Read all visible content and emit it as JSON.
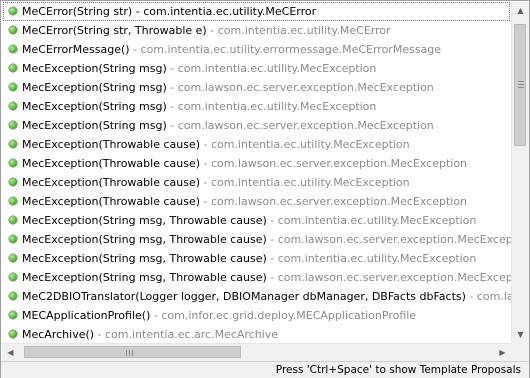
{
  "proposals": [
    {
      "signature": "MeCError(String str)",
      "package": "com.intentia.ec.utility.MeCError",
      "selected": true
    },
    {
      "signature": "MeCError(String str, Throwable e)",
      "package": "com.intentia.ec.utility.MeCError"
    },
    {
      "signature": "MeCErrorMessage()",
      "package": "com.intentia.ec.utility.errormessage.MeCErrorMessage"
    },
    {
      "signature": "MecException(String msg)",
      "package": "com.intentia.ec.utility.MecException"
    },
    {
      "signature": "MecException(String msg)",
      "package": "com.lawson.ec.server.exception.MecException"
    },
    {
      "signature": "MecException(String msg)",
      "package": "com.intentia.ec.utility.MecException"
    },
    {
      "signature": "MecException(String msg)",
      "package": "com.lawson.ec.server.exception.MecException"
    },
    {
      "signature": "MecException(Throwable cause)",
      "package": "com.intentia.ec.utility.MecException"
    },
    {
      "signature": "MecException(Throwable cause)",
      "package": "com.lawson.ec.server.exception.MecException"
    },
    {
      "signature": "MecException(Throwable cause)",
      "package": "com.intentia.ec.utility.MecException"
    },
    {
      "signature": "MecException(Throwable cause)",
      "package": "com.lawson.ec.server.exception.MecException"
    },
    {
      "signature": "MecException(String msg, Throwable cause)",
      "package": "com.intentia.ec.utility.MecException"
    },
    {
      "signature": "MecException(String msg, Throwable cause)",
      "package": "com.lawson.ec.server.exception.MecException"
    },
    {
      "signature": "MecException(String msg, Throwable cause)",
      "package": "com.intentia.ec.utility.MecException"
    },
    {
      "signature": "MecException(String msg, Throwable cause)",
      "package": "com.lawson.ec.server.exception.MecException"
    },
    {
      "signature": "MeC2DBIOTranslator(Logger logger, DBIOManager dbManager, DBFacts dbFacts)",
      "package": "com.lawson.ec.server.exception"
    },
    {
      "signature": "MECApplicationProfile()",
      "package": "com.infor.ec.grid.deploy.MECApplicationProfile"
    },
    {
      "signature": "MecArchive()",
      "package": "com.intentia.ec.arc.MecArchive"
    }
  ],
  "separator": " - ",
  "icons": {
    "proposal": "public-method-icon",
    "color": "#5cb83a"
  },
  "scrollbars": {
    "up": "scroll-up-icon",
    "down": "scroll-down-icon",
    "left": "scroll-left-icon",
    "right": "scroll-right-icon"
  },
  "status": {
    "hint": "Press 'Ctrl+Space' to show Template Proposals"
  }
}
